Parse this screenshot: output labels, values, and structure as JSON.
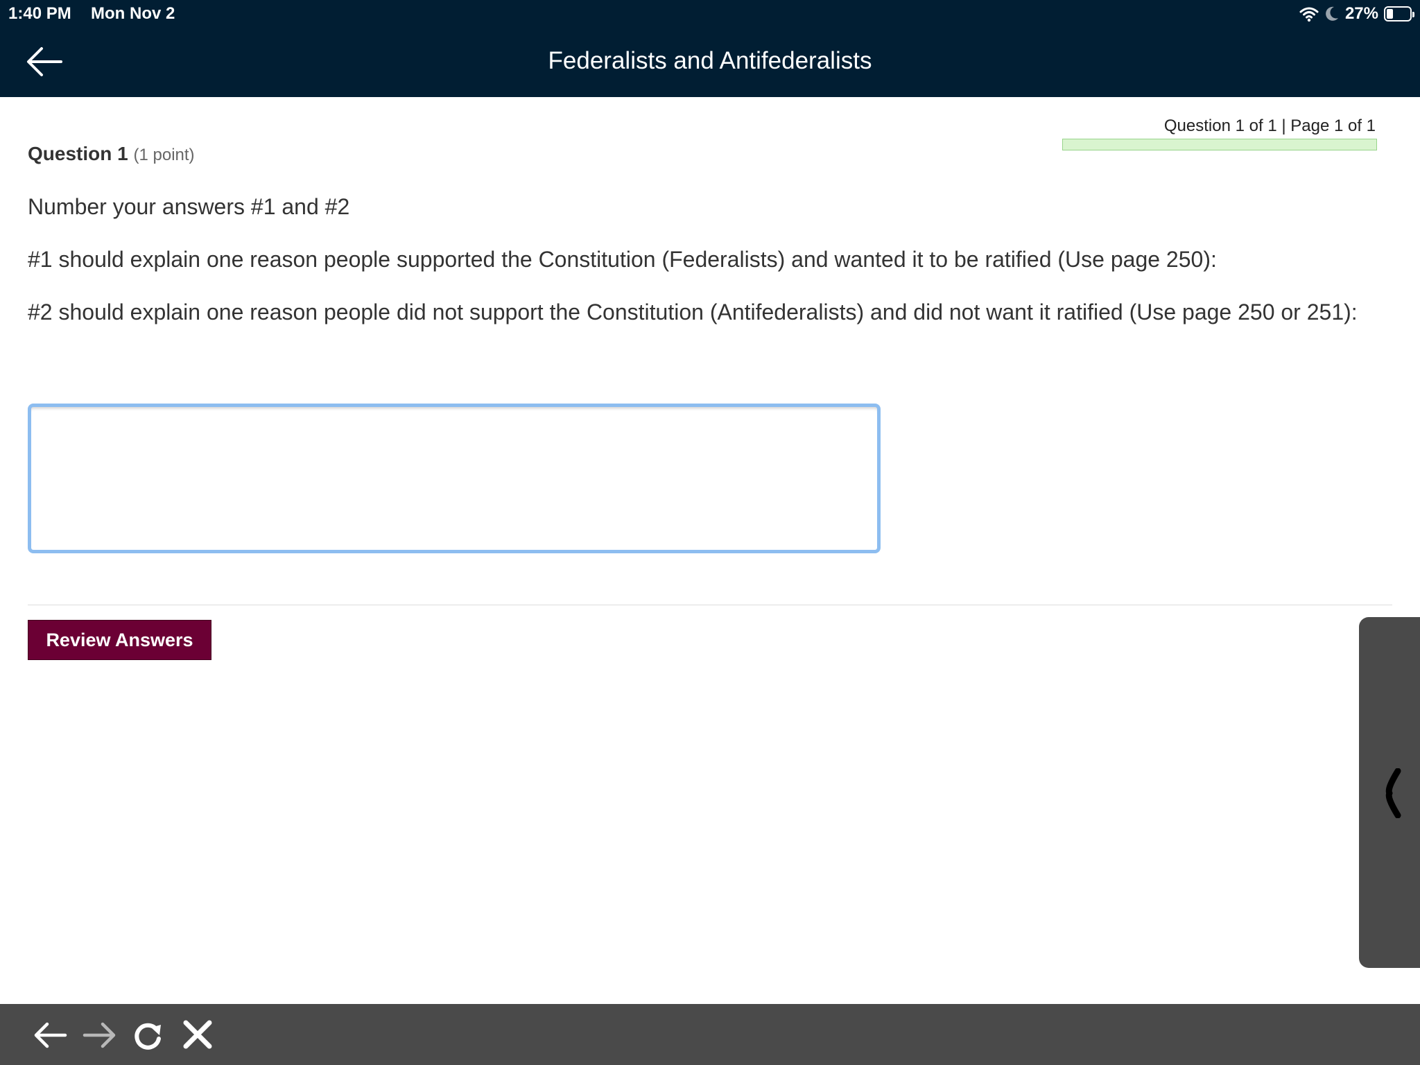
{
  "status_bar": {
    "time": "1:40 PM",
    "date": "Mon Nov 2",
    "battery": "27%",
    "battery_level": 0.27,
    "icons": [
      "wifi-icon",
      "moon-icon",
      "battery-icon"
    ]
  },
  "header": {
    "title": "Federalists and Antifederalists",
    "back_icon": "arrow-left-icon"
  },
  "quiz": {
    "progress_label": "Question 1 of 1 | Page 1 of 1",
    "progress_fraction": 1.0,
    "question_number": "Question 1",
    "question_points": "(1 point)",
    "line1": "Number your answers #1 and #2",
    "line2": "#1 should explain one reason people supported the Constitution (Federalists) and wanted it to be ratified (Use page 250):",
    "line3": "#2 should explain one reason people did not support the Constitution (Antifederalists) and did not want it ratified (Use page 250 or 251):",
    "answer_value": "",
    "review_button": "Review Answers"
  },
  "colors": {
    "header_bg": "#011e33",
    "button_bg": "#6b0034",
    "focus_border": "#8dbdf0",
    "toolbar_bg": "#4a4a4a"
  },
  "toolbar": {
    "icons": [
      "arrow-left-icon",
      "arrow-right-icon",
      "reload-icon",
      "close-icon"
    ]
  }
}
